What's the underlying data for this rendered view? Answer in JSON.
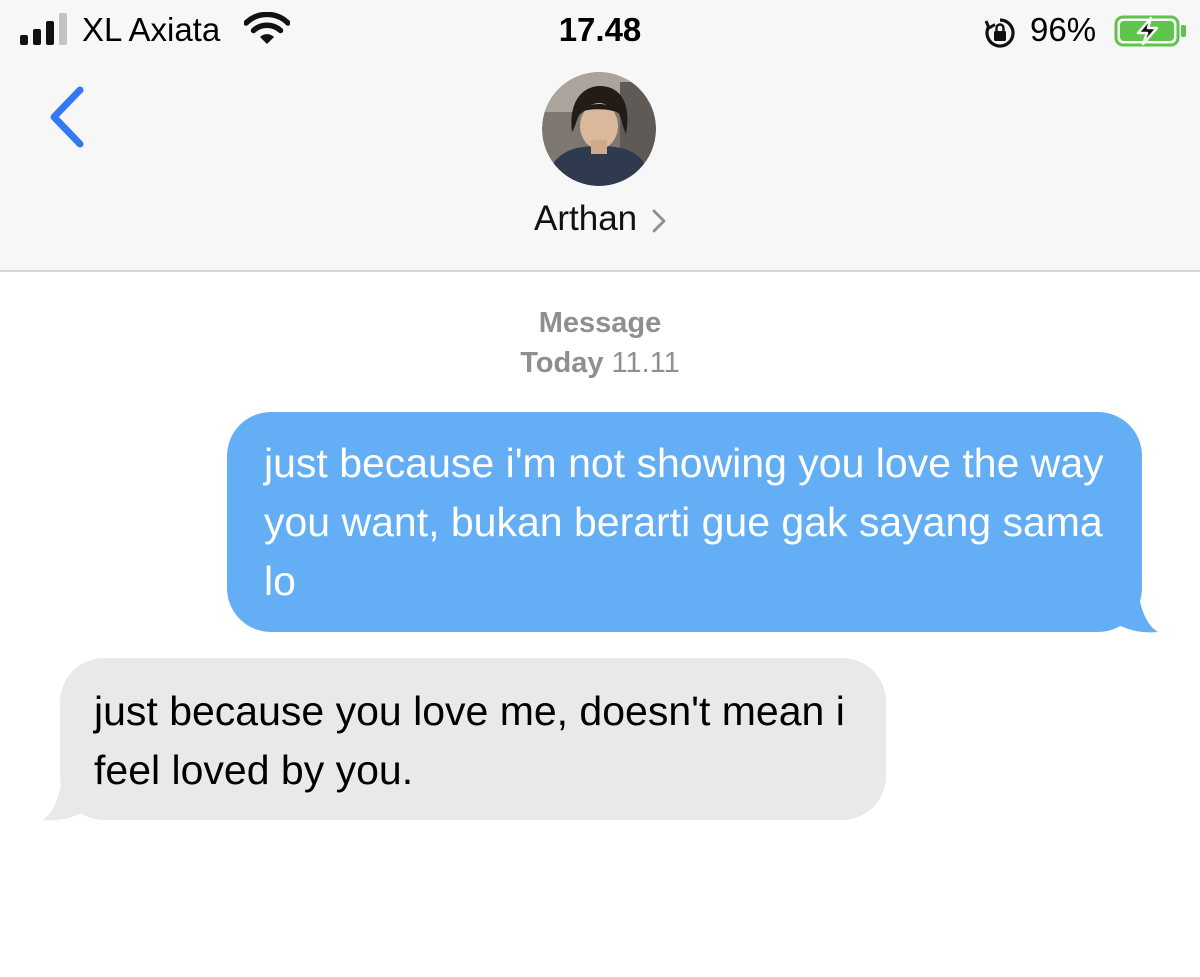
{
  "status_bar": {
    "carrier": "XL Axiata",
    "time": "17.48",
    "battery_percent": "96%",
    "icons": [
      "signal-icon",
      "wifi-icon",
      "orientation-lock-icon",
      "battery-charging-icon"
    ]
  },
  "nav": {
    "back_icon": "chevron-left-icon",
    "contact_name": "Arthan",
    "contact_chevron_icon": "chevron-right-icon"
  },
  "thread": {
    "service_label": "Message",
    "day_label": "Today",
    "time_label": "11.11"
  },
  "messages": [
    {
      "direction": "outgoing",
      "text": "just because i'm not showing you love the way you want, bukan berarti gue gak sayang sama lo"
    },
    {
      "direction": "incoming",
      "text": "just because you love me, doesn't mean i feel loved by you."
    }
  ],
  "colors": {
    "accent": "#3478f6",
    "outgoing_bubble": "#64aef5",
    "incoming_bubble": "#e9e9eb",
    "timestamp_gray": "#8e8e93",
    "battery_green": "#5ec44b",
    "header_bg": "#f7f7f7"
  }
}
